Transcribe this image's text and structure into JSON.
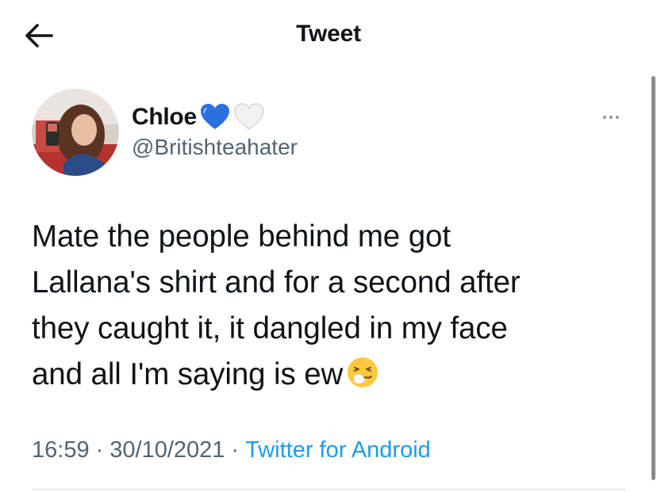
{
  "header": {
    "title": "Tweet",
    "back_icon": "arrow-left-icon"
  },
  "author": {
    "display_name": "Chloe",
    "badges": [
      {
        "icon": "blue-heart-icon",
        "color": "#2b6fe0"
      },
      {
        "icon": "white-heart-icon",
        "color": "#e6e6e6"
      }
    ],
    "handle": "@Britishteahater"
  },
  "tweet": {
    "lines": [
      "Mate the people behind me got",
      "Lallana's shirt and for a second after",
      "they caught it, it dangled in my face",
      "and all I'm saying is ew"
    ],
    "emoji": "sneezing-face-icon"
  },
  "meta": {
    "time": "16:59",
    "separator": "·",
    "date": "30/10/2021",
    "source": "Twitter for Android"
  },
  "colors": {
    "text": "#0f1419",
    "secondary": "#536471",
    "link": "#1d9bf0",
    "divider": "#cfd9de"
  }
}
